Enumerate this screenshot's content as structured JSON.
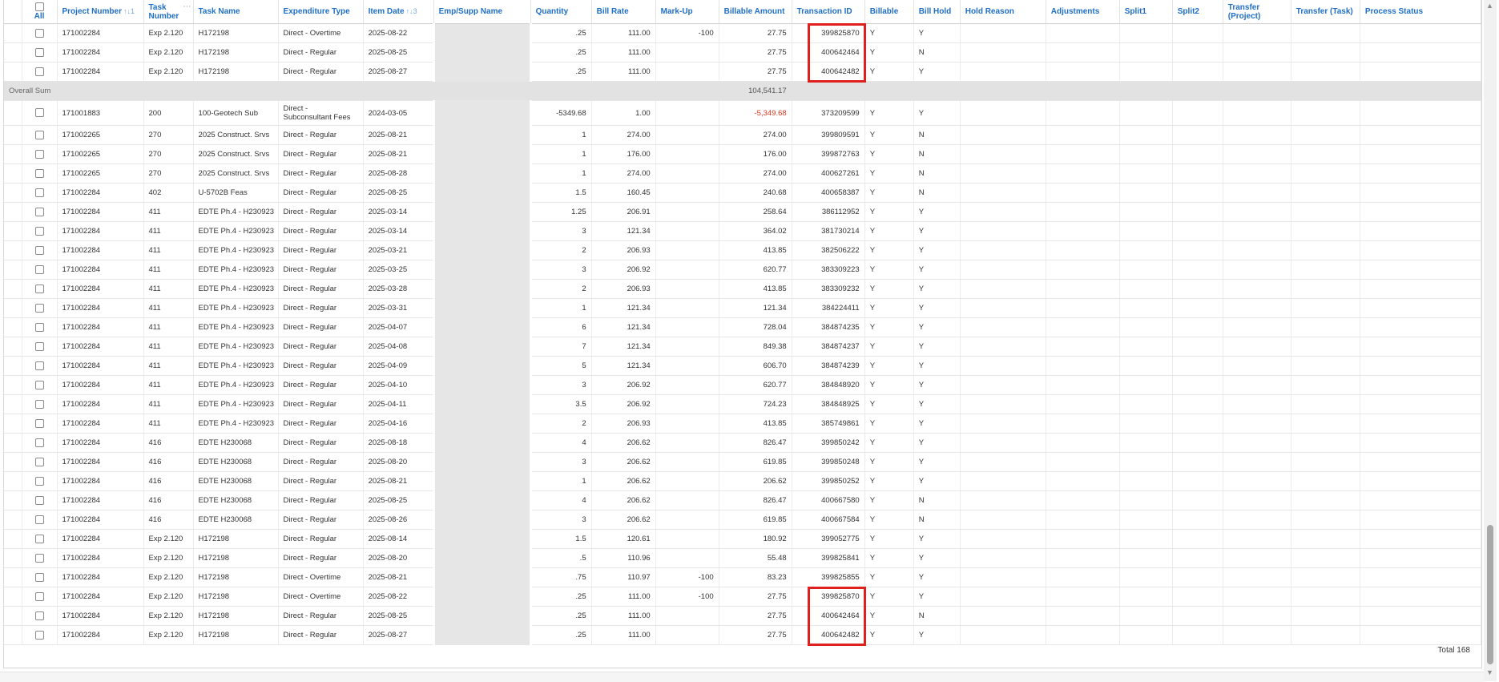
{
  "columns": {
    "all": "All",
    "project_number": "Project Number",
    "project_number_sort": "↑↓1",
    "task_number": "Task Number",
    "task_menu": "⋯",
    "task_name": "Task Name",
    "expenditure_type": "Expenditure Type",
    "item_date": "Item Date",
    "item_date_sort": "↑↓3",
    "emp_supp_name": "Emp/Supp Name",
    "quantity": "Quantity",
    "bill_rate": "Bill Rate",
    "mark_up": "Mark-Up",
    "billable_amount": "Billable Amount",
    "transaction_id": "Transaction ID",
    "billable": "Billable",
    "bill_hold": "Bill Hold",
    "hold_reason": "Hold Reason",
    "adjustments": "Adjustments",
    "split1": "Split1",
    "split2": "Split2",
    "transfer_project": "Transfer (Project)",
    "transfer_task": "Transfer (Task)",
    "process_status": "Process Status"
  },
  "top_rows": [
    {
      "project": "171002284",
      "task": "Exp 2.120",
      "task_name": "H172198",
      "exp_type": "Direct - Overtime",
      "date": "2025-08-22",
      "qty": ".25",
      "rate": "111.00",
      "markup": "-100",
      "amount": "27.75",
      "txid": "399825870",
      "billable": "Y",
      "hold": "Y"
    },
    {
      "project": "171002284",
      "task": "Exp 2.120",
      "task_name": "H172198",
      "exp_type": "Direct - Regular",
      "date": "2025-08-25",
      "qty": ".25",
      "rate": "111.00",
      "markup": "",
      "amount": "27.75",
      "txid": "400642464",
      "billable": "Y",
      "hold": "N"
    },
    {
      "project": "171002284",
      "task": "Exp 2.120",
      "task_name": "H172198",
      "exp_type": "Direct - Regular",
      "date": "2025-08-27",
      "qty": ".25",
      "rate": "111.00",
      "markup": "",
      "amount": "27.75",
      "txid": "400642482",
      "billable": "Y",
      "hold": "Y"
    }
  ],
  "overall_sum": {
    "label": "Overall Sum",
    "amount": "104,541.17"
  },
  "rows": [
    {
      "project": "171001883",
      "task": "200",
      "task_name": "100-Geotech Sub",
      "exp_type": "Direct - Subconsultant Fees",
      "date": "2024-03-05",
      "qty": "-5349.68",
      "rate": "1.00",
      "markup": "",
      "amount": "-5,349.68",
      "txid": "373209599",
      "billable": "Y",
      "hold": "Y"
    },
    {
      "project": "171002265",
      "task": "270",
      "task_name": "2025 Construct. Srvs",
      "exp_type": "Direct - Regular",
      "date": "2025-08-21",
      "qty": "1",
      "rate": "274.00",
      "markup": "",
      "amount": "274.00",
      "txid": "399809591",
      "billable": "Y",
      "hold": "N"
    },
    {
      "project": "171002265",
      "task": "270",
      "task_name": "2025 Construct. Srvs",
      "exp_type": "Direct - Regular",
      "date": "2025-08-21",
      "qty": "1",
      "rate": "176.00",
      "markup": "",
      "amount": "176.00",
      "txid": "399872763",
      "billable": "Y",
      "hold": "N"
    },
    {
      "project": "171002265",
      "task": "270",
      "task_name": "2025 Construct. Srvs",
      "exp_type": "Direct - Regular",
      "date": "2025-08-28",
      "qty": "1",
      "rate": "274.00",
      "markup": "",
      "amount": "274.00",
      "txid": "400627261",
      "billable": "Y",
      "hold": "N"
    },
    {
      "project": "171002284",
      "task": "402",
      "task_name": "U-5702B Feas",
      "exp_type": "Direct - Regular",
      "date": "2025-08-25",
      "qty": "1.5",
      "rate": "160.45",
      "markup": "",
      "amount": "240.68",
      "txid": "400658387",
      "billable": "Y",
      "hold": "N"
    },
    {
      "project": "171002284",
      "task": "411",
      "task_name": "EDTE Ph.4 - H230923",
      "exp_type": "Direct - Regular",
      "date": "2025-03-14",
      "qty": "1.25",
      "rate": "206.91",
      "markup": "",
      "amount": "258.64",
      "txid": "386112952",
      "billable": "Y",
      "hold": "Y"
    },
    {
      "project": "171002284",
      "task": "411",
      "task_name": "EDTE Ph.4 - H230923",
      "exp_type": "Direct - Regular",
      "date": "2025-03-14",
      "qty": "3",
      "rate": "121.34",
      "markup": "",
      "amount": "364.02",
      "txid": "381730214",
      "billable": "Y",
      "hold": "Y"
    },
    {
      "project": "171002284",
      "task": "411",
      "task_name": "EDTE Ph.4 - H230923",
      "exp_type": "Direct - Regular",
      "date": "2025-03-21",
      "qty": "2",
      "rate": "206.93",
      "markup": "",
      "amount": "413.85",
      "txid": "382506222",
      "billable": "Y",
      "hold": "Y"
    },
    {
      "project": "171002284",
      "task": "411",
      "task_name": "EDTE Ph.4 - H230923",
      "exp_type": "Direct - Regular",
      "date": "2025-03-25",
      "qty": "3",
      "rate": "206.92",
      "markup": "",
      "amount": "620.77",
      "txid": "383309223",
      "billable": "Y",
      "hold": "Y"
    },
    {
      "project": "171002284",
      "task": "411",
      "task_name": "EDTE Ph.4 - H230923",
      "exp_type": "Direct - Regular",
      "date": "2025-03-28",
      "qty": "2",
      "rate": "206.93",
      "markup": "",
      "amount": "413.85",
      "txid": "383309232",
      "billable": "Y",
      "hold": "Y"
    },
    {
      "project": "171002284",
      "task": "411",
      "task_name": "EDTE Ph.4 - H230923",
      "exp_type": "Direct - Regular",
      "date": "2025-03-31",
      "qty": "1",
      "rate": "121.34",
      "markup": "",
      "amount": "121.34",
      "txid": "384224411",
      "billable": "Y",
      "hold": "Y"
    },
    {
      "project": "171002284",
      "task": "411",
      "task_name": "EDTE Ph.4 - H230923",
      "exp_type": "Direct - Regular",
      "date": "2025-04-07",
      "qty": "6",
      "rate": "121.34",
      "markup": "",
      "amount": "728.04",
      "txid": "384874235",
      "billable": "Y",
      "hold": "Y"
    },
    {
      "project": "171002284",
      "task": "411",
      "task_name": "EDTE Ph.4 - H230923",
      "exp_type": "Direct - Regular",
      "date": "2025-04-08",
      "qty": "7",
      "rate": "121.34",
      "markup": "",
      "amount": "849.38",
      "txid": "384874237",
      "billable": "Y",
      "hold": "Y"
    },
    {
      "project": "171002284",
      "task": "411",
      "task_name": "EDTE Ph.4 - H230923",
      "exp_type": "Direct - Regular",
      "date": "2025-04-09",
      "qty": "5",
      "rate": "121.34",
      "markup": "",
      "amount": "606.70",
      "txid": "384874239",
      "billable": "Y",
      "hold": "Y"
    },
    {
      "project": "171002284",
      "task": "411",
      "task_name": "EDTE Ph.4 - H230923",
      "exp_type": "Direct - Regular",
      "date": "2025-04-10",
      "qty": "3",
      "rate": "206.92",
      "markup": "",
      "amount": "620.77",
      "txid": "384848920",
      "billable": "Y",
      "hold": "Y"
    },
    {
      "project": "171002284",
      "task": "411",
      "task_name": "EDTE Ph.4 - H230923",
      "exp_type": "Direct - Regular",
      "date": "2025-04-11",
      "qty": "3.5",
      "rate": "206.92",
      "markup": "",
      "amount": "724.23",
      "txid": "384848925",
      "billable": "Y",
      "hold": "Y"
    },
    {
      "project": "171002284",
      "task": "411",
      "task_name": "EDTE Ph.4 - H230923",
      "exp_type": "Direct - Regular",
      "date": "2025-04-16",
      "qty": "2",
      "rate": "206.93",
      "markup": "",
      "amount": "413.85",
      "txid": "385749861",
      "billable": "Y",
      "hold": "Y"
    },
    {
      "project": "171002284",
      "task": "416",
      "task_name": "EDTE H230068",
      "exp_type": "Direct - Regular",
      "date": "2025-08-18",
      "qty": "4",
      "rate": "206.62",
      "markup": "",
      "amount": "826.47",
      "txid": "399850242",
      "billable": "Y",
      "hold": "Y"
    },
    {
      "project": "171002284",
      "task": "416",
      "task_name": "EDTE H230068",
      "exp_type": "Direct - Regular",
      "date": "2025-08-20",
      "qty": "3",
      "rate": "206.62",
      "markup": "",
      "amount": "619.85",
      "txid": "399850248",
      "billable": "Y",
      "hold": "Y"
    },
    {
      "project": "171002284",
      "task": "416",
      "task_name": "EDTE H230068",
      "exp_type": "Direct - Regular",
      "date": "2025-08-21",
      "qty": "1",
      "rate": "206.62",
      "markup": "",
      "amount": "206.62",
      "txid": "399850252",
      "billable": "Y",
      "hold": "Y"
    },
    {
      "project": "171002284",
      "task": "416",
      "task_name": "EDTE H230068",
      "exp_type": "Direct - Regular",
      "date": "2025-08-25",
      "qty": "4",
      "rate": "206.62",
      "markup": "",
      "amount": "826.47",
      "txid": "400667580",
      "billable": "Y",
      "hold": "N"
    },
    {
      "project": "171002284",
      "task": "416",
      "task_name": "EDTE H230068",
      "exp_type": "Direct - Regular",
      "date": "2025-08-26",
      "qty": "3",
      "rate": "206.62",
      "markup": "",
      "amount": "619.85",
      "txid": "400667584",
      "billable": "Y",
      "hold": "N"
    },
    {
      "project": "171002284",
      "task": "Exp 2.120",
      "task_name": "H172198",
      "exp_type": "Direct - Regular",
      "date": "2025-08-14",
      "qty": "1.5",
      "rate": "120.61",
      "markup": "",
      "amount": "180.92",
      "txid": "399052775",
      "billable": "Y",
      "hold": "Y"
    },
    {
      "project": "171002284",
      "task": "Exp 2.120",
      "task_name": "H172198",
      "exp_type": "Direct - Regular",
      "date": "2025-08-20",
      "qty": ".5",
      "rate": "110.96",
      "markup": "",
      "amount": "55.48",
      "txid": "399825841",
      "billable": "Y",
      "hold": "Y"
    },
    {
      "project": "171002284",
      "task": "Exp 2.120",
      "task_name": "H172198",
      "exp_type": "Direct - Overtime",
      "date": "2025-08-21",
      "qty": ".75",
      "rate": "110.97",
      "markup": "-100",
      "amount": "83.23",
      "txid": "399825855",
      "billable": "Y",
      "hold": "Y"
    },
    {
      "project": "171002284",
      "task": "Exp 2.120",
      "task_name": "H172198",
      "exp_type": "Direct - Overtime",
      "date": "2025-08-22",
      "qty": ".25",
      "rate": "111.00",
      "markup": "-100",
      "amount": "27.75",
      "txid": "399825870",
      "billable": "Y",
      "hold": "Y"
    },
    {
      "project": "171002284",
      "task": "Exp 2.120",
      "task_name": "H172198",
      "exp_type": "Direct - Regular",
      "date": "2025-08-25",
      "qty": ".25",
      "rate": "111.00",
      "markup": "",
      "amount": "27.75",
      "txid": "400642464",
      "billable": "Y",
      "hold": "N"
    },
    {
      "project": "171002284",
      "task": "Exp 2.120",
      "task_name": "H172198",
      "exp_type": "Direct - Regular",
      "date": "2025-08-27",
      "qty": ".25",
      "rate": "111.00",
      "markup": "",
      "amount": "27.75",
      "txid": "400642482",
      "billable": "Y",
      "hold": "Y"
    }
  ],
  "footer": {
    "total": "Total 168"
  },
  "colors": {
    "header_link": "#1f6fc5",
    "negative": "#d9361f",
    "highlight": "#e0201c",
    "sum_row": "#e2e2e2"
  }
}
